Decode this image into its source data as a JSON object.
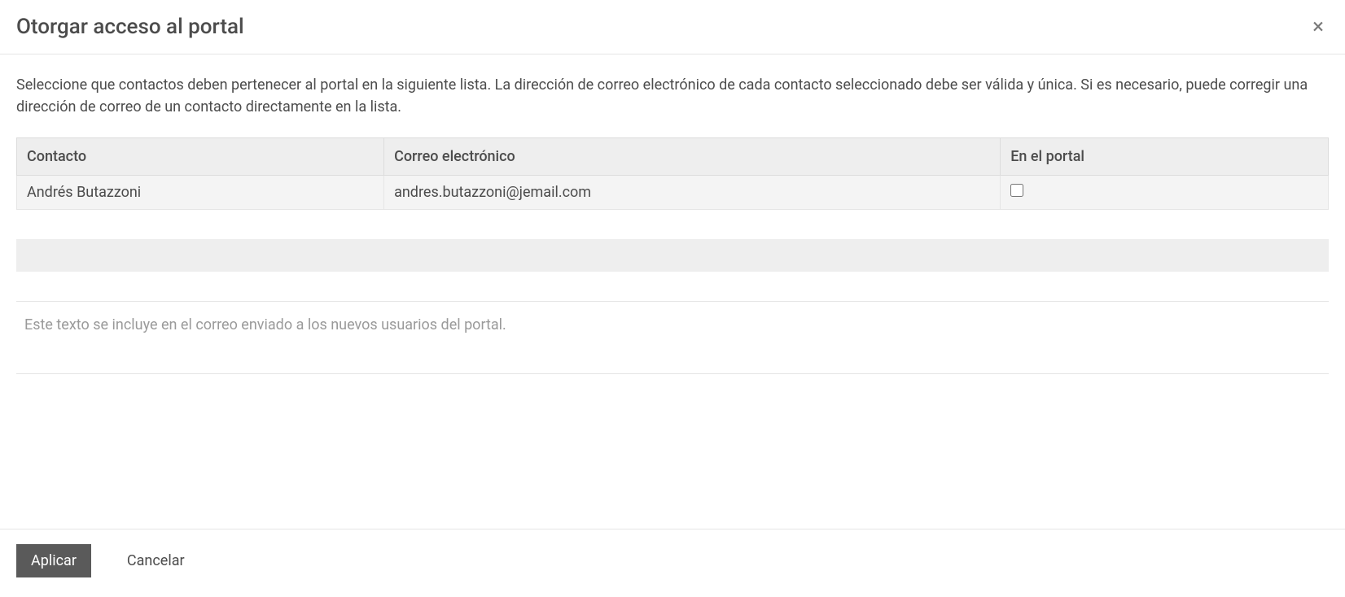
{
  "header": {
    "title": "Otorgar acceso al portal",
    "close_glyph": "×"
  },
  "body": {
    "instructions": "Seleccione que contactos deben pertenecer al portal en la siguiente lista. La dirección de correo electrónico de cada contacto seleccionado debe ser válida y única. Si es necesario, puede corregir una dirección de correo de un contacto directamente en la lista.",
    "table": {
      "columns": {
        "contact": "Contacto",
        "email": "Correo electrónico",
        "in_portal": "En el portal"
      },
      "rows": [
        {
          "contact": "Andrés Butazzoni",
          "email": "andres.butazzoni@jemail.com",
          "in_portal": false
        }
      ]
    },
    "message": {
      "placeholder": "Este texto se incluye en el correo enviado a los nuevos usuarios del portal.",
      "value": ""
    }
  },
  "footer": {
    "apply_label": "Aplicar",
    "cancel_label": "Cancelar"
  }
}
